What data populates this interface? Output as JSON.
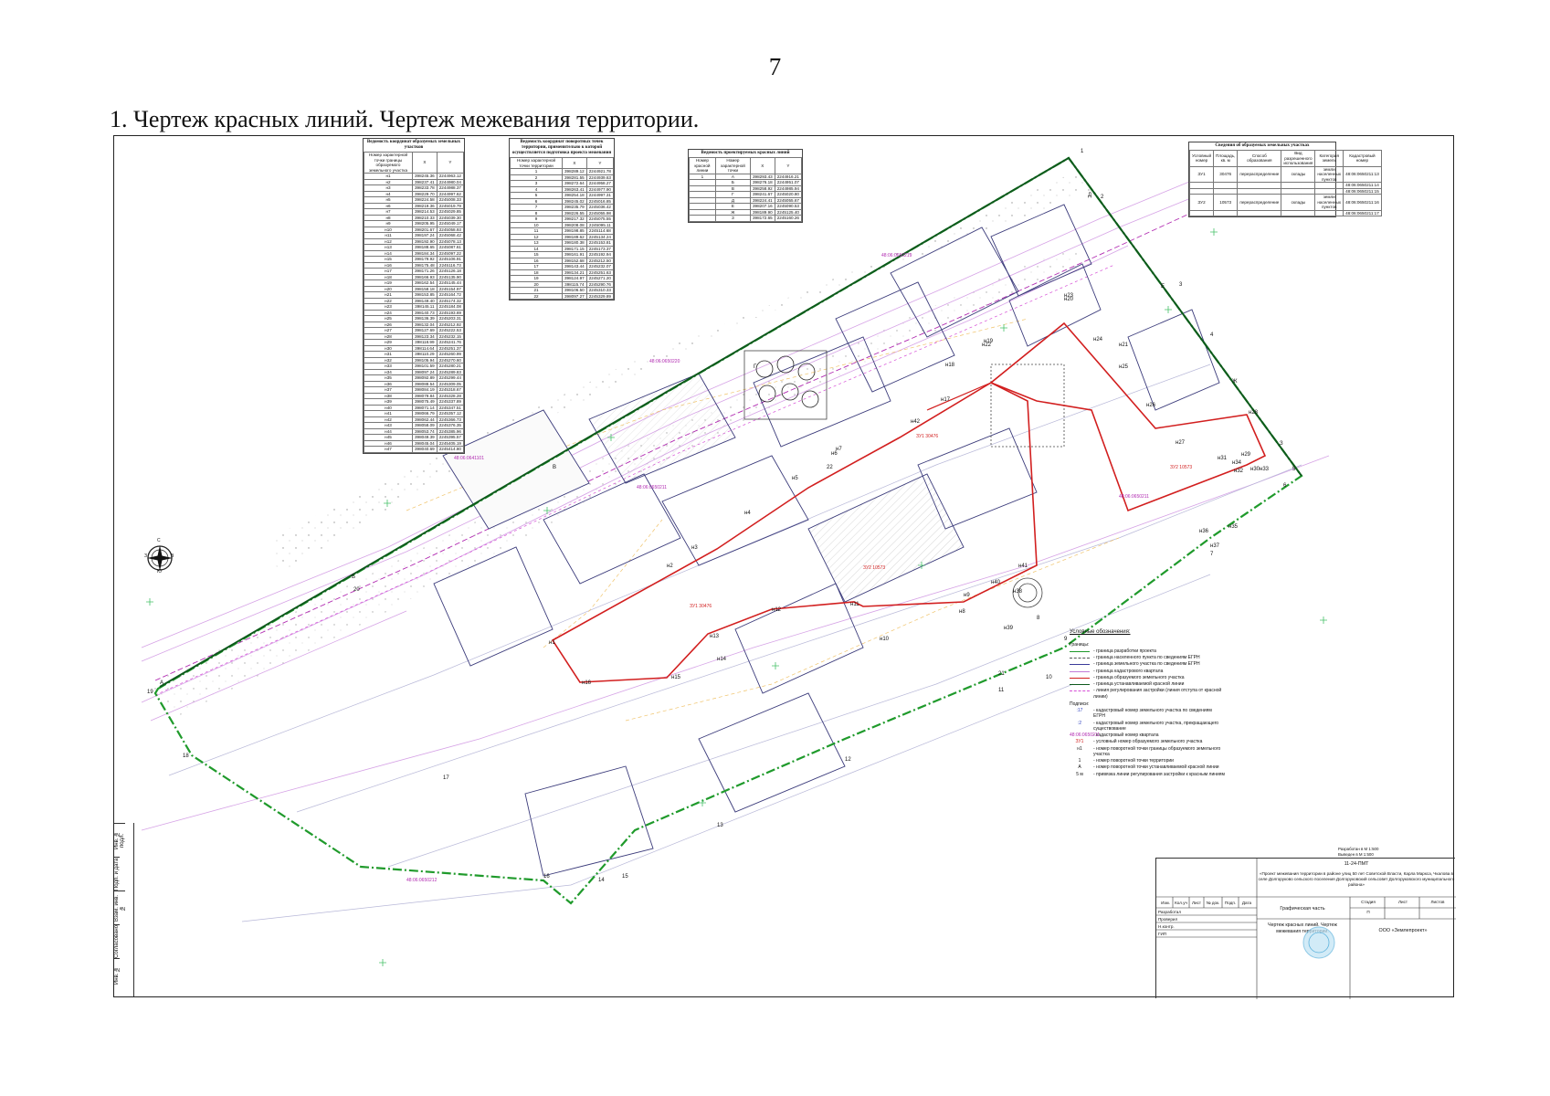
{
  "page_number": "7",
  "heading": "1. Чертеж красных линий. Чертеж межевания территории.",
  "tables": {
    "t1": {
      "title": "Ведомость координат образуемых земельных участков",
      "columns": [
        "Номер характерной точки границы образуемого земельного участка",
        "X",
        "Y"
      ],
      "rows": [
        [
          "н1",
          "398245.36",
          "2244963.12"
        ],
        [
          "н2",
          "398237.41",
          "2244980.04"
        ],
        [
          "н3",
          "398233.78",
          "2244988.37"
        ],
        [
          "н4",
          "398229.70",
          "2244997.62"
        ],
        [
          "н5",
          "398224.58",
          "2245008.33"
        ],
        [
          "н6",
          "398219.36",
          "2245019.79"
        ],
        [
          "н7",
          "398214.53",
          "2245029.85"
        ],
        [
          "н8",
          "398210.33",
          "2245039.30"
        ],
        [
          "н9",
          "398205.95",
          "2245049.17"
        ],
        [
          "н10",
          "398201.67",
          "2245058.93"
        ],
        [
          "н11",
          "398197.24",
          "2245068.42"
        ],
        [
          "н12",
          "398192.90",
          "2245078.13"
        ],
        [
          "н13",
          "398188.65",
          "2245087.61"
        ],
        [
          "н14",
          "398184.34",
          "2245097.22"
        ],
        [
          "н15",
          "398179.92",
          "2245106.91"
        ],
        [
          "н16",
          "398175.48",
          "2245116.73"
        ],
        [
          "н17",
          "398171.26",
          "2245126.18"
        ],
        [
          "н18",
          "398166.93",
          "2245135.90"
        ],
        [
          "н19",
          "398162.54",
          "2245145.44"
        ],
        [
          "н20",
          "398158.18",
          "2245154.97"
        ],
        [
          "н21",
          "398153.85",
          "2245164.72"
        ],
        [
          "н22",
          "398149.40",
          "2245174.32"
        ],
        [
          "н23",
          "398145.11",
          "2245184.08"
        ],
        [
          "н24",
          "398140.73",
          "2245193.69"
        ],
        [
          "н25",
          "398136.39",
          "2245203.31"
        ],
        [
          "н26",
          "398132.04",
          "2245212.92"
        ],
        [
          "н27",
          "398127.69",
          "2245222.53"
        ],
        [
          "н28",
          "398123.34",
          "2245232.15"
        ],
        [
          "н29",
          "398118.99",
          "2245241.76"
        ],
        [
          "н30",
          "398114.64",
          "2245251.37"
        ],
        [
          "н31",
          "398110.29",
          "2245260.99"
        ],
        [
          "н32",
          "398105.94",
          "2245270.60"
        ],
        [
          "н33",
          "398101.59",
          "2245280.21"
        ],
        [
          "н34",
          "398097.24",
          "2245289.83"
        ],
        [
          "н35",
          "398092.89",
          "2245299.44"
        ],
        [
          "н36",
          "398088.54",
          "2245309.05"
        ],
        [
          "н37",
          "398084.19",
          "2245318.67"
        ],
        [
          "н38",
          "398079.84",
          "2245328.28"
        ],
        [
          "н39",
          "398075.49",
          "2245337.89"
        ],
        [
          "н40",
          "398071.14",
          "2245347.51"
        ],
        [
          "н41",
          "398066.79",
          "2245357.12"
        ],
        [
          "н42",
          "398062.44",
          "2245366.73"
        ],
        [
          "н43",
          "398058.09",
          "2245376.35"
        ],
        [
          "н44",
          "398053.74",
          "2245385.96"
        ],
        [
          "н45",
          "398049.39",
          "2245395.57"
        ],
        [
          "н46",
          "398045.04",
          "2245405.19"
        ],
        [
          "н47",
          "398040.69",
          "2245414.80"
        ]
      ]
    },
    "t2": {
      "title": "Ведомость координат поворотных точек территории, применительно к которой осуществляется подготовка проекта межевания",
      "columns": [
        "Номер характерной точки территории",
        "X",
        "Y"
      ],
      "rows": [
        [
          "1",
          "398289.12",
          "2244921.78"
        ],
        [
          "2",
          "398281.55",
          "2244939.63"
        ],
        [
          "3",
          "398272.64",
          "2244958.27"
        ],
        [
          "4",
          "398263.41",
          "2244977.90"
        ],
        [
          "5",
          "398254.18",
          "2244997.31"
        ],
        [
          "6",
          "398245.02",
          "2245016.85"
        ],
        [
          "7",
          "398235.79",
          "2245036.42"
        ],
        [
          "8",
          "398226.55",
          "2245055.98"
        ],
        [
          "9",
          "398217.32",
          "2245075.55"
        ],
        [
          "10",
          "398208.08",
          "2245095.11"
        ],
        [
          "11",
          "398198.85",
          "2245114.68"
        ],
        [
          "12",
          "398189.62",
          "2245134.24"
        ],
        [
          "13",
          "398180.38",
          "2245153.81"
        ],
        [
          "14",
          "398171.15",
          "2245173.37"
        ],
        [
          "15",
          "398161.91",
          "2245192.94"
        ],
        [
          "16",
          "398152.68",
          "2245212.50"
        ],
        [
          "17",
          "398143.44",
          "2245232.07"
        ],
        [
          "18",
          "398134.21",
          "2245251.63"
        ],
        [
          "19",
          "398124.97",
          "2245271.20"
        ],
        [
          "20",
          "398115.74",
          "2245290.76"
        ],
        [
          "21",
          "398106.50",
          "2245310.33"
        ],
        [
          "22",
          "398097.27",
          "2245329.89"
        ]
      ]
    },
    "t3": {
      "title": "Ведомость проектируемых красных линий",
      "columns": [
        "Номер красной линии",
        "Номер характерной точки",
        "X",
        "Y"
      ],
      "rows": [
        [
          "1",
          "А",
          "398293.43",
          "2244916.21"
        ],
        [
          "",
          "Б",
          "398276.18",
          "2244951.07"
        ],
        [
          "",
          "В",
          "398258.92",
          "2244985.94"
        ],
        [
          "",
          "Г",
          "398241.67",
          "2245020.80"
        ],
        [
          "",
          "Д",
          "398224.41",
          "2245055.67"
        ],
        [
          "",
          "Е",
          "398207.16",
          "2245090.53"
        ],
        [
          "",
          "Ж",
          "398189.90",
          "2245125.40"
        ],
        [
          "",
          "З",
          "398172.65",
          "2245160.26"
        ]
      ]
    },
    "t4": {
      "title": "Сведения об образуемых земельных участках",
      "columns": [
        "Условный номер",
        "Площадь, кв. м",
        "Способ образования",
        "Вид разрешенного использования",
        "Категория земель",
        "Кадастровый номер"
      ],
      "rows": [
        [
          "ЗУ1",
          "30476",
          "перераспределение",
          "склады",
          "земли населенных пунктов",
          "48:06:0650211:13"
        ],
        [
          "",
          "",
          "",
          "",
          "",
          "48:06:0650211:14"
        ],
        [
          "",
          "",
          "",
          "",
          "",
          "48:06:0650211:15"
        ],
        [
          "ЗУ2",
          "10573",
          "перераспределение",
          "склады",
          "земли населенных пунктов",
          "48:06:0650211:16"
        ],
        [
          "",
          "",
          "",
          "",
          "",
          "48:06:0650211:17"
        ]
      ]
    }
  },
  "map": {
    "corner_labels": [
      "1",
      "2",
      "3",
      "4",
      "5",
      "6",
      "7",
      "8",
      "9",
      "10",
      "11",
      "12",
      "13",
      "14",
      "15",
      "16",
      "17",
      "18",
      "19",
      "20",
      "21",
      "22"
    ],
    "node_labels": [
      "н1",
      "н2",
      "н3",
      "н4",
      "н5",
      "н6",
      "н7",
      "н8",
      "н9",
      "н10",
      "н11",
      "н12",
      "н13",
      "н14",
      "н15",
      "н16",
      "н17",
      "н18",
      "н19",
      "н20",
      "н21",
      "н22",
      "н23",
      "н24",
      "н25",
      "н26",
      "н27",
      "н28",
      "н29",
      "н30",
      "н31",
      "н32",
      "н33",
      "н34",
      "н35",
      "н36",
      "н37",
      "н38",
      "н39",
      "н40",
      "н41",
      "н42"
    ],
    "red_line_letters": [
      "А",
      "Б",
      "В",
      "Г",
      "Д",
      "Е",
      "Ж",
      "З"
    ],
    "quarter_numbers": [
      "48:06:0650219",
      "48:06:0650220",
      "48:06:0641101",
      "48:06:0650211",
      "48:06:0650211",
      "48:06:0650212"
    ],
    "parcel_labels": [
      "ЗУ1 30476",
      "ЗУ1 30476",
      "ЗУ2 10573",
      "ЗУ2 10573"
    ],
    "compass_letters": [
      "С",
      "Ю",
      "З",
      "В"
    ],
    "scale_label": "в 1:500"
  },
  "legend": {
    "title": "Условные обозначения:",
    "section_borders": "Границы:",
    "items": [
      {
        "label": "- граница разработки проекта",
        "color": "#1f9a2b",
        "style": "line"
      },
      {
        "label": "- граница населенного пункта по сведениям ЕГРН",
        "color": "#555555",
        "style": "dash"
      },
      {
        "label": "- граница земельного участка по сведениям ЕГРН",
        "color": "#3b3b9a",
        "style": "line"
      },
      {
        "label": "- граница кадастрового квартала",
        "color": "#c27ad8",
        "style": "line"
      },
      {
        "label": "- граница образуемого земельного участка",
        "color": "#d21f1f",
        "style": "line"
      },
      {
        "label": "- граница устанавливаемой красной линии",
        "color": "#0e5a1c",
        "style": "line"
      },
      {
        "label": "- линия регулирования застройки (линия отступа от красной линии)",
        "color": "#d64fd6",
        "style": "dash"
      }
    ],
    "section_captions": "Подписи:",
    "captions": [
      {
        "sym": ":17",
        "label": "- кадастровый номер земельного участка по сведениям ЕГРН",
        "color": "#2a3fbf"
      },
      {
        "sym": ":2",
        "label": "- кадастровый номер земельного участка, прекращающего существование",
        "color": "#2a3fbf"
      },
      {
        "sym": "48:06:0650211",
        "label": "- кадастровый номер квартала",
        "color": "#b12ab1"
      },
      {
        "sym": "ЗУ1",
        "label": "- условный номер образуемого земельного участка",
        "color": "#d21f1f"
      },
      {
        "sym": "н1",
        "label": "- номер поворотной точки границы образуемого земельного участка",
        "color": "#111111"
      },
      {
        "sym": "1",
        "label": "- номер поворотной точки территории",
        "color": "#111111"
      },
      {
        "sym": "А",
        "label": "- номер поворотной точки устанавливаемой красной линии",
        "color": "#111111"
      },
      {
        "sym": "5 м",
        "label": "- привязка линии регулирования застройки к красным линиям",
        "color": "#111111"
      }
    ]
  },
  "stamp": {
    "code": "11-24-ПМТ",
    "project": "«Проект межевания территории в районе улиц 50 лет Советской Власти, Карла Маркса, Чкалова в селе Долгоруково сельского поселения Долгоруковский сельсовет Долгоруковского муниципального района»",
    "stage": "Графическая часть",
    "sheet_title": "Чертеж красных линий. Чертеж межевания территории.",
    "company": "ООО «Землепроект»",
    "stage_header": "Стадия",
    "stage_value": "П",
    "sheet_header": "Лист",
    "sheets_header": "Листов",
    "developed": "Разработан в М 1:500",
    "printed": "Выведен в М 1:500",
    "roles": [
      "Разработал",
      "Проверил",
      "Н.контр.",
      "ГИП"
    ],
    "cols": [
      "Изм.",
      "Кол.уч",
      "Лист",
      "№ док.",
      "Подп.",
      "Дата"
    ]
  },
  "left_strip": [
    "Инв. № подл.",
    "Подп. и дата",
    "Взам. инв. №",
    "Согласовано",
    "Инв. №"
  ]
}
